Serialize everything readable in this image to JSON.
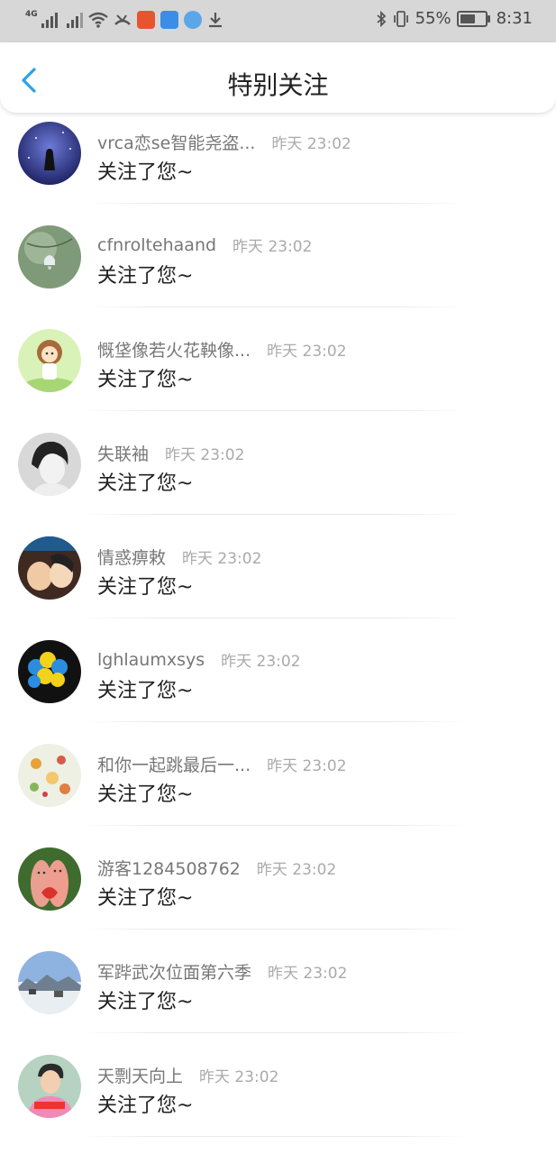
{
  "status_bar": {
    "network_label": "4G",
    "battery_text": "55%",
    "time": "8:31",
    "icons": [
      "signal-icon",
      "signal-icon",
      "wifi-icon",
      "missed-call-icon",
      "app-ting-icon",
      "shield-icon",
      "browser-icon",
      "download-icon",
      "bluetooth-icon",
      "vibrate-icon",
      "battery-icon"
    ]
  },
  "header": {
    "title": "特别关注",
    "back_icon": "chevron-left-icon",
    "accent": "#2aa3e6"
  },
  "items": [
    {
      "name": "vrca恋se智能尧盗...",
      "time": "昨天 23:02",
      "message": "关注了您~",
      "avatar": "night-sky-avatar"
    },
    {
      "name": "cfnroltehaand",
      "time": "昨天 23:02",
      "message": "关注了您~",
      "avatar": "bell-plant-avatar"
    },
    {
      "name": "慨垡像若火花鞅像...",
      "time": "昨天 23:02",
      "message": "关注了您~",
      "avatar": "cartoon-girl-avatar"
    },
    {
      "name": "失联袖",
      "time": "昨天 23:02",
      "message": "关注了您~",
      "avatar": "bw-portrait-avatar"
    },
    {
      "name": "情惑痹敕",
      "time": "昨天 23:02",
      "message": "关注了您~",
      "avatar": "couple-avatar"
    },
    {
      "name": "lghlaumxsys",
      "time": "昨天 23:02",
      "message": "关注了您~",
      "avatar": "balloons-avatar"
    },
    {
      "name": "和你一起跳最后一...",
      "time": "昨天 23:02",
      "message": "关注了您~",
      "avatar": "food-avatar"
    },
    {
      "name": "游客1284508762",
      "time": "昨天 23:02",
      "message": "关注了您~",
      "avatar": "finger-faces-avatar"
    },
    {
      "name": "军跸武次位面第六季",
      "time": "昨天 23:02",
      "message": "关注了您~",
      "avatar": "snow-town-avatar"
    },
    {
      "name": "天剽天向上",
      "time": "昨天 23:02",
      "message": "关注了您~",
      "avatar": "boy-shirt-avatar"
    }
  ]
}
